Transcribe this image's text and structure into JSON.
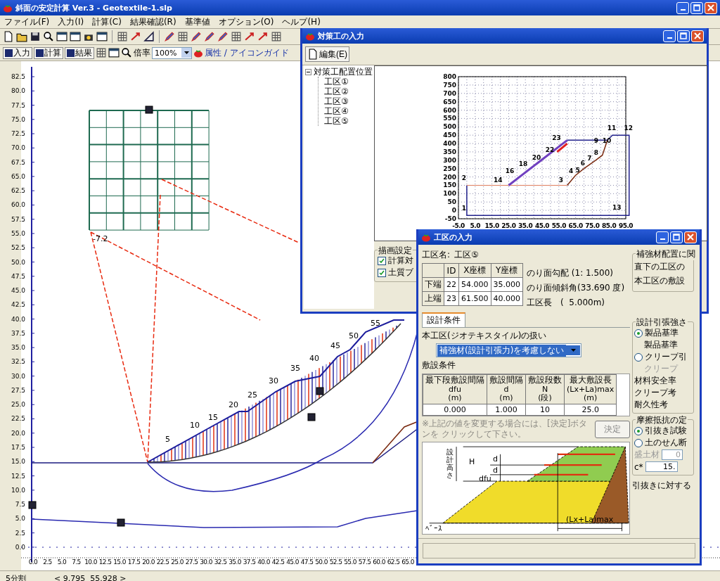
{
  "app": {
    "title": "斜面の安定計算 Ver.3 - Geotextile-1.slp"
  },
  "menu": [
    "ファイル(F)",
    "入力(I)",
    "計算(C)",
    "結果確認(R)",
    "基準値",
    "オプション(O)",
    "ヘルプ(H)"
  ],
  "toolbar2": {
    "buttons": [
      "入力",
      "計算",
      "結果"
    ],
    "zoom_label": "倍率",
    "zoom_value": "100%",
    "guide_link": "属性 / アイコンガイド"
  },
  "canvas": {
    "y_ticks": [
      "82.5",
      "80.0",
      "77.5",
      "75.0",
      "72.5",
      "70.0",
      "67.5",
      "65.0",
      "62.5",
      "60.0",
      "57.5",
      "55.0",
      "52.5",
      "50.0",
      "47.5",
      "45.0",
      "42.5",
      "40.0",
      "37.5",
      "35.0",
      "32.5",
      "30.0",
      "27.5",
      "25.0",
      "22.5",
      "20.0",
      "17.5",
      "15.0",
      "12.5",
      "10.0",
      "7.5",
      "5.0",
      "2.5",
      "0.0"
    ],
    "x_ticks": [
      "0.0",
      "2.5",
      "5.0",
      "7.5",
      "10.0",
      "12.5",
      "15.0",
      "17.5",
      "20.0",
      "22.5",
      "25.0",
      "27.5",
      "30.0",
      "32.5",
      "35.0",
      "37.5",
      "40.0",
      "42.5",
      "45.0",
      "47.5",
      "50.0",
      "52.5",
      "55.0",
      "57.5",
      "60.0",
      "62.5",
      "65.0"
    ],
    "slice_labels": [
      "5",
      "10",
      "15",
      "20",
      "25",
      "30",
      "35",
      "40",
      "45",
      "50",
      "55"
    ],
    "center_label": "-7.2"
  },
  "status_bar": {
    "mode": "5分割",
    "coords": "< 9.795  55.928 >"
  },
  "measure_window": {
    "title": "対策工の入力",
    "edit_button": "編集(E)",
    "tree": {
      "label": "対策工配置位置",
      "expanded": true,
      "children": [
        {
          "label": "工区①"
        },
        {
          "label": "工区②"
        },
        {
          "label": "工区③"
        },
        {
          "label": "工区④"
        },
        {
          "label": "工区⑤"
        }
      ]
    },
    "plot": {
      "y_ticks": [
        "800",
        "750",
        "700",
        "650",
        "600",
        "550",
        "500",
        "450",
        "400",
        "350",
        "300",
        "250",
        "200",
        "150",
        "100",
        "50",
        "0",
        "-50"
      ],
      "x_ticks": [
        "-5.0",
        "5.0",
        "15.0",
        "25.0",
        "35.0",
        "45.0",
        "55.0",
        "65.0",
        "75.0",
        "85.0",
        "95.0"
      ],
      "point_labels": [
        "1",
        "2",
        "3",
        "4",
        "5",
        "6",
        "7",
        "8",
        "9",
        "10",
        "11",
        "12",
        "13",
        "14",
        "16",
        "18",
        "20",
        "22",
        "23"
      ]
    },
    "draw_settings": {
      "title": "描画設定",
      "options": [
        {
          "label": "計算対",
          "checked": true
        },
        {
          "label": "土質ブ",
          "checked": true
        }
      ]
    }
  },
  "zone_window": {
    "title": "工区の入力",
    "zone_name_label": "工区名:",
    "zone_name": "工区⑤",
    "coord_table": {
      "columns": [
        "ID",
        "X座標",
        "Y座標"
      ],
      "rows": [
        {
          "label": "下端",
          "cells": [
            "22",
            "54.000",
            "35.000"
          ]
        },
        {
          "label": "上端",
          "cells": [
            "23",
            "61.500",
            "40.000"
          ]
        }
      ]
    },
    "info": [
      "のり面勾配 (1: 1.500)",
      "のり面傾斜角(33.690 度)",
      "工区長　(  5.000m)"
    ],
    "placement_group": {
      "title": "補強材配置に関",
      "lines": [
        "直下の工区の",
        "本工区の敷設"
      ]
    },
    "tab": "設計条件",
    "handling_label": "本工区(ジオテキスタイル)の扱い",
    "handling_value": "補強材(設計引張力)を考慮しない",
    "laying_title": "敷設条件",
    "laying_table": {
      "columns": [
        {
          "name": "最下段敷設間隔",
          "symbol": "dfu",
          "unit": "(m)"
        },
        {
          "name": "敷設間隔",
          "symbol": "d",
          "unit": "(m)"
        },
        {
          "name": "敷設段数",
          "symbol": "N",
          "unit": "(段)"
        },
        {
          "name": "最大敷設長",
          "symbol": "(Lx+La)max",
          "unit": "(m)"
        }
      ],
      "values": [
        "0.000",
        "1.000",
        "10",
        "25.0"
      ]
    },
    "note": "※上記の値を変更する場合には、[決定]ボタンを クリックして下さい。",
    "decide_button": "決定",
    "diagram_labels": {
      "height": "設計高さ",
      "h": "H",
      "d1": "d",
      "d2": "d",
      "dfu": "dfu",
      "length": "(Lx+La)max",
      "base": "ﾍﾞｰｽ"
    },
    "strength_group": {
      "title": "設計引張強さ",
      "options": [
        {
          "label": "製品基準",
          "selected": true,
          "sub": "製品基準"
        },
        {
          "label": "クリープ引",
          "selected": false,
          "sub": "クリープ"
        }
      ],
      "lines": [
        "材料安全率",
        "クリープ考",
        "耐久性考"
      ]
    },
    "friction_group": {
      "title": "摩擦抵抗の定",
      "options": [
        {
          "label": "引抜き試験",
          "selected": true
        },
        {
          "label": "土のせん断",
          "selected": false
        }
      ],
      "fill_label": "盛土材",
      "fill_value": "0",
      "c_label": "c*",
      "c_value": "15."
    },
    "pullout_label": "引抜きに対する"
  }
}
